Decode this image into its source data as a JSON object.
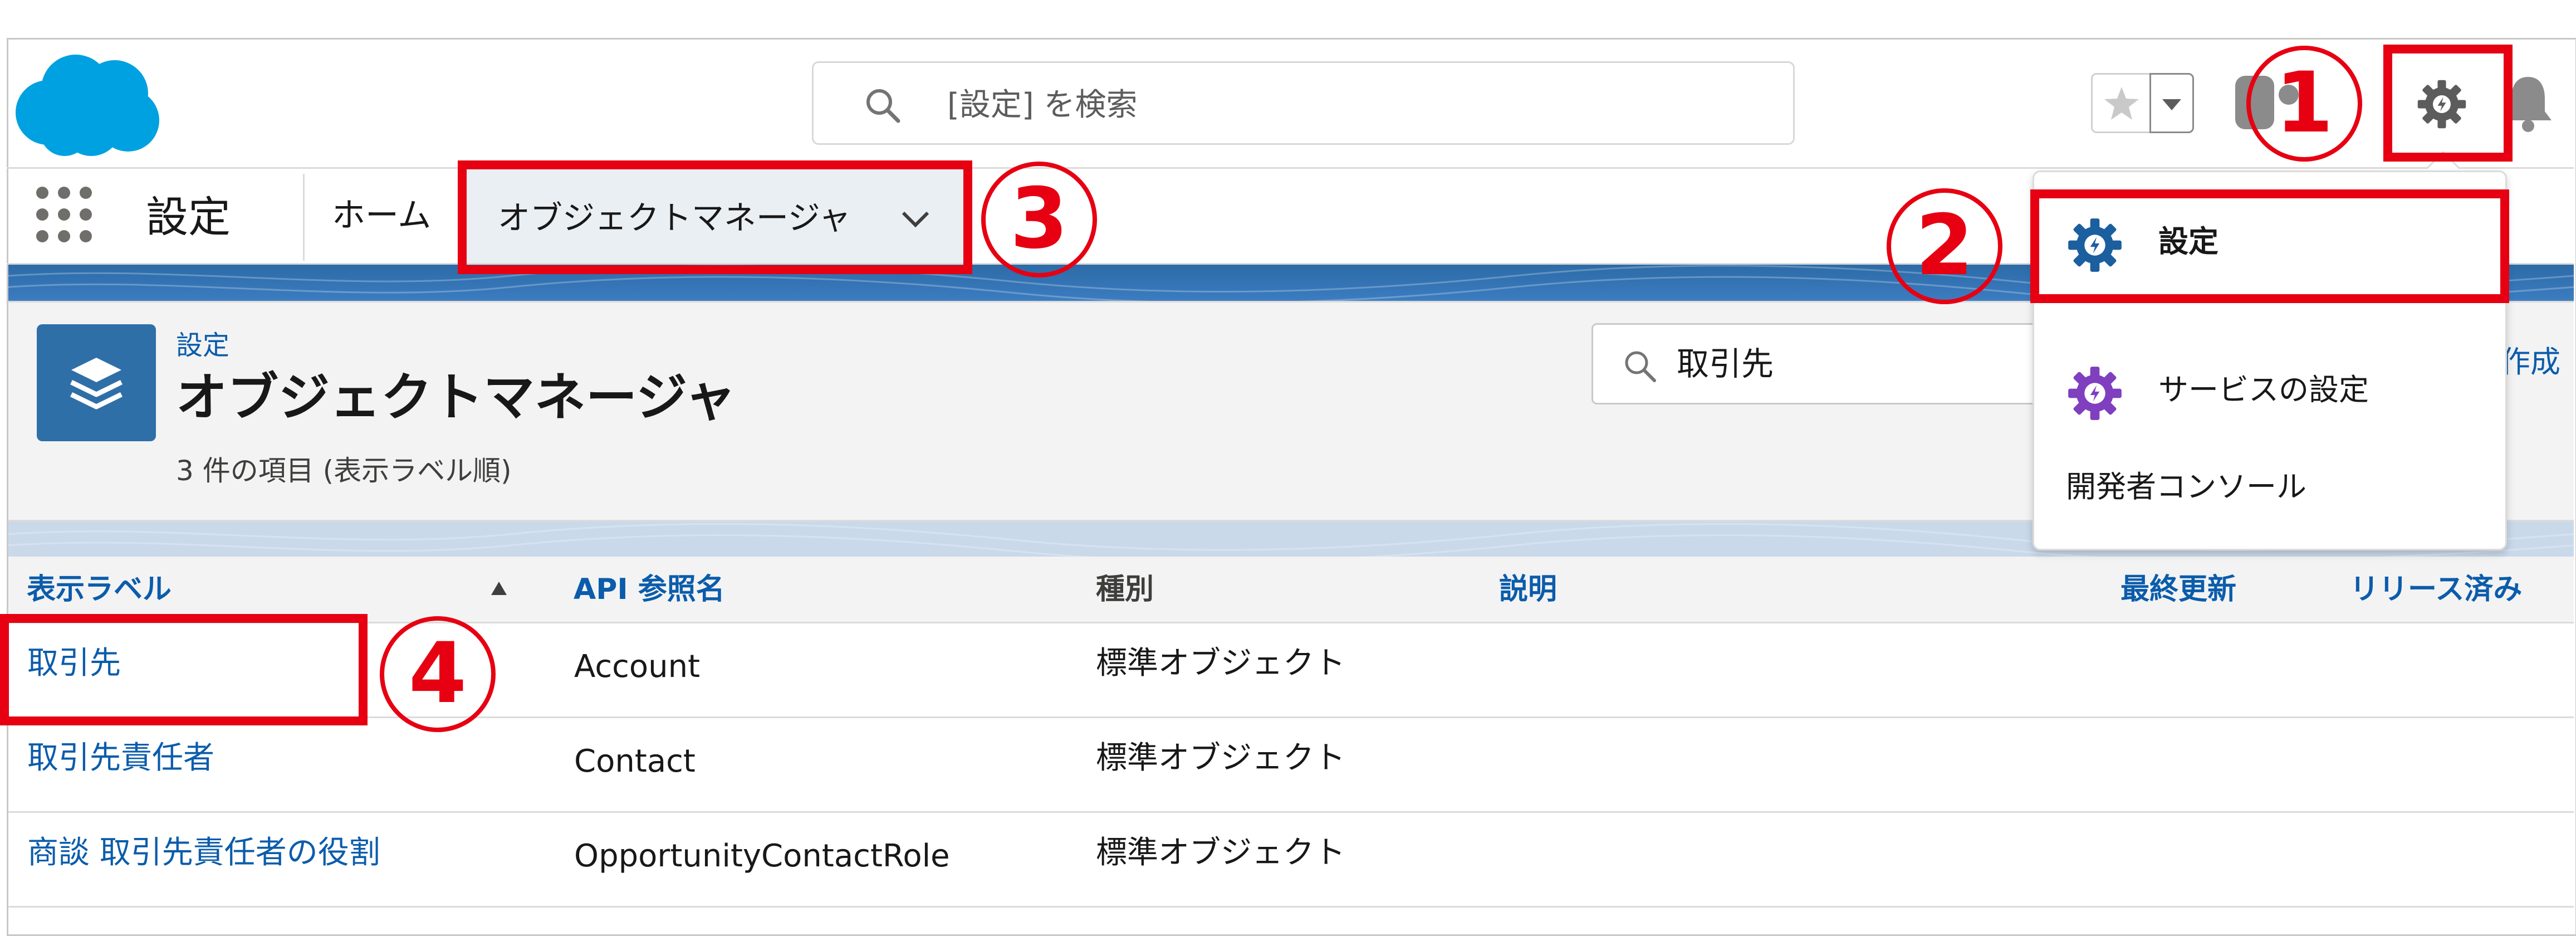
{
  "header": {
    "search_placeholder": "[設定] を検索",
    "icons": [
      "salesforce-cloud-logo",
      "search-icon",
      "star-icon",
      "chevron-down-icon",
      "help-icon",
      "gear-icon",
      "bell-icon"
    ]
  },
  "nav": {
    "app_name": "設定",
    "home": "ホーム",
    "active_tab": "オブジェクトマネージャ"
  },
  "page_header": {
    "breadcrumb": "設定",
    "title": "オブジェクトマネージャ",
    "item_count": "3 件の項目 (表示ラベル順)",
    "quick_find_value": "取引先",
    "create_button": "作成"
  },
  "table": {
    "columns": [
      "表示ラベル",
      "API 参照名",
      "種別",
      "説明",
      "最終更新",
      "リリース済み"
    ],
    "rows": [
      {
        "label": "取引先",
        "api_name": "Account",
        "type": "標準オブジェクト"
      },
      {
        "label": "取引先責任者",
        "api_name": "Contact",
        "type": "標準オブジェクト"
      },
      {
        "label": "商談 取引先責任者の役割",
        "api_name": "OpportunityContactRole",
        "type": "標準オブジェクト"
      }
    ]
  },
  "setup_menu": {
    "items": [
      {
        "label": "設定",
        "icon": "gear-bolt-icon",
        "color": "#1b5f9e"
      },
      {
        "label": "サービスの設定",
        "icon": "gear-bolt-icon",
        "color": "#7f3fbf"
      },
      {
        "label": "開発者コンソール"
      }
    ]
  },
  "annotations": {
    "step1": "1",
    "step2": "2",
    "step3": "3",
    "step4": "4",
    "color": "#e60012"
  },
  "colors": {
    "brand": "#00a1e0",
    "link": "#0b5cab",
    "band": "#2d6ba7"
  }
}
